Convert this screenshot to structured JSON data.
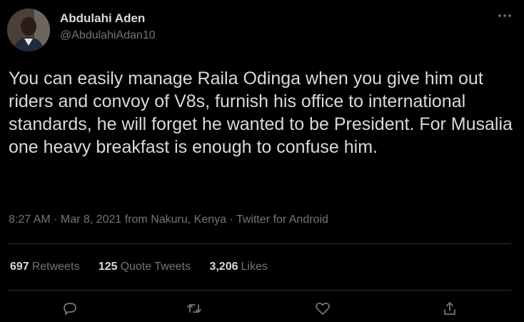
{
  "author": {
    "name": "Abdulahi Aden",
    "handle": "@AbdulahiAdan10",
    "more_icon": "more-icon"
  },
  "tweet": {
    "text": "You can easily manage Raila Odinga when you give him out riders and convoy of V8s, furnish his office to international standards, he will forget he wanted to be President. For Musalia one heavy breakfast is enough to confuse him.",
    "meta": "8:27 AM · Mar 8, 2021 from Nakuru, Kenya · Twitter for Android"
  },
  "stats": [
    {
      "count": "697",
      "label": "Retweets"
    },
    {
      "count": "125",
      "label": "Quote Tweets"
    },
    {
      "count": "3,206",
      "label": "Likes"
    }
  ],
  "actions": [
    "reply-icon",
    "retweet-icon",
    "like-icon",
    "share-icon"
  ],
  "colors": {
    "background": "#000000",
    "text": "#d9d9d9",
    "secondary": "#6e767d",
    "divider": "#2f3336"
  }
}
